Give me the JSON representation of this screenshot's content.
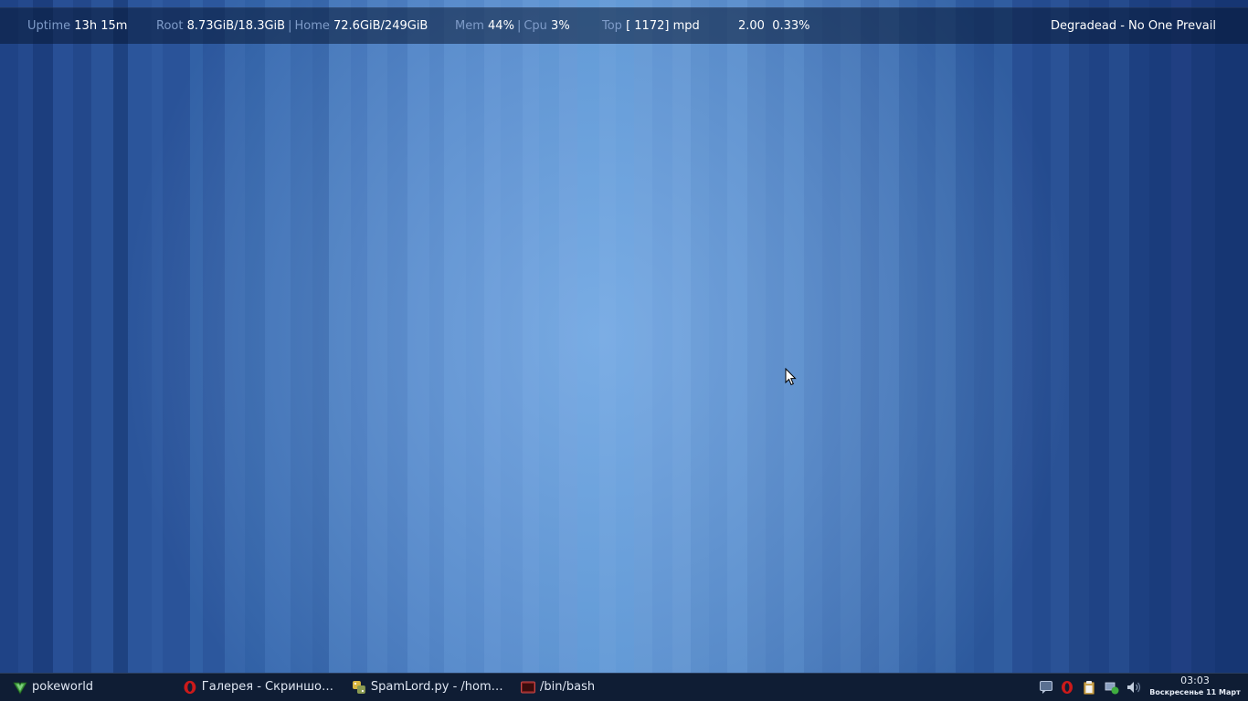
{
  "topbar": {
    "uptime": {
      "label": "Uptime",
      "value": "13h 15m"
    },
    "root": {
      "label": "Root",
      "value": "8.73GiB/18.3GiB"
    },
    "home": {
      "label": "Home",
      "value": "72.6GiB/249GiB"
    },
    "mem": {
      "label": "Mem",
      "value": "44%"
    },
    "cpu": {
      "label": "Cpu",
      "value": "3%"
    },
    "separator": "|",
    "top": {
      "label": "Top",
      "value": "[ 1172] mpd",
      "load": "2.00",
      "pct": "0.33%"
    },
    "now_playing": "Degradead - No One Prevail"
  },
  "taskbar": {
    "tasks": [
      {
        "label": "pokeworld",
        "icon": "vim-icon"
      },
      {
        "label": "Галерея - Скриншот...",
        "icon": "opera-icon"
      },
      {
        "label": "SpamLord.py - /home...",
        "icon": "python-editor-icon"
      },
      {
        "label": "/bin/bash",
        "icon": "terminal-icon"
      }
    ],
    "tray": [
      "chat-icon",
      "opera-icon",
      "clipboard-icon",
      "network-icon",
      "volume-icon"
    ],
    "clock": {
      "time": "03:03",
      "date": "Воскресенье 11 Март"
    }
  },
  "colors": {
    "panel_label": "#7f9cc9",
    "panel_value": "#ffffff",
    "taskbar_bg": "#0f1d34",
    "opera_red": "#cc1a1a",
    "vim_green": "#3e9a3e"
  }
}
